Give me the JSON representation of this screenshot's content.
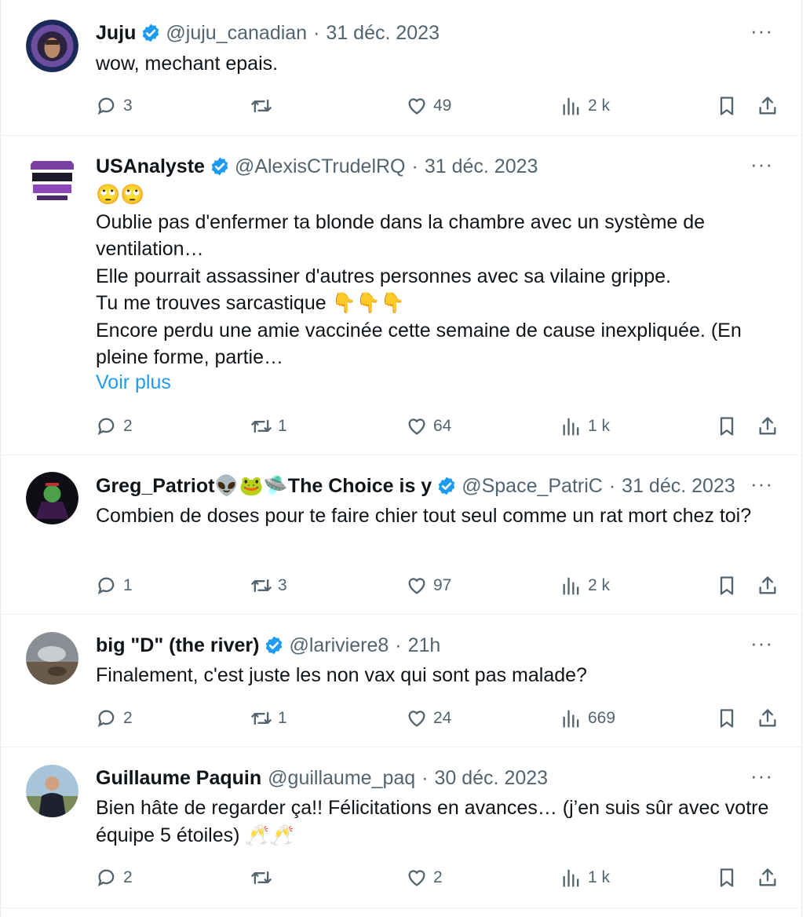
{
  "icons": {
    "reply": "speech-bubble-icon",
    "retweet": "retweet-icon",
    "like": "heart-icon",
    "views": "bar-chart-icon",
    "bookmark": "bookmark-icon",
    "share": "share-upload-icon",
    "more": "more-dots-icon",
    "verified": "verified-badge-icon"
  },
  "colors": {
    "verified": "#1d9bf0",
    "link": "#1d9bf0",
    "secondary": "#536471"
  },
  "more_label": "···",
  "tweets": [
    {
      "name": "Juju",
      "handle": "@juju_canadian",
      "sep": "·",
      "date": "31 déc. 2023",
      "text": "wow, mechant epais.",
      "replies": "3",
      "retweets": "",
      "likes": "49",
      "views": "2 k"
    },
    {
      "name": "USAnalyste",
      "handle": "@AlexisCTrudelRQ",
      "sep": "·",
      "date": "31 déc. 2023",
      "text": "🙄🙄\nOublie pas d'enfermer ta blonde dans la chambre avec un système de ventilation…\nElle pourrait assassiner d'autres personnes avec sa vilaine grippe.\nTu me trouves sarcastique 👇👇👇\nEncore perdu une amie vaccinée cette semaine de cause inexpliquée. (En pleine forme, partie…",
      "show_more": "Voir plus",
      "replies": "2",
      "retweets": "1",
      "likes": "64",
      "views": "1 k"
    },
    {
      "name": "Greg_Patriot👽🐸🛸The Choice is y",
      "handle": "@Space_PatriC",
      "sep": "·",
      "date": "31 déc. 2023",
      "text": "Combien de doses pour te faire chier tout seul comme un rat mort chez toi?",
      "replies": "1",
      "retweets": "3",
      "likes": "97",
      "views": "2 k"
    },
    {
      "name": "big \"D\" (the river)",
      "handle": "@lariviere8",
      "sep": "·",
      "date": "21h",
      "text": "Finalement, c'est juste les non vax qui sont pas malade?",
      "replies": "2",
      "retweets": "1",
      "likes": "24",
      "views": "669"
    },
    {
      "name": "Guillaume Paquin",
      "handle": "@guillaume_paq",
      "sep": "·",
      "date": "30 déc. 2023",
      "text": "Bien hâte de regarder ça!! Félicitations en avances… (j’en suis sûr avec votre équipe 5 étoiles) 🥂🥂",
      "replies": "2",
      "retweets": "",
      "likes": "2",
      "views": "1 k"
    }
  ]
}
